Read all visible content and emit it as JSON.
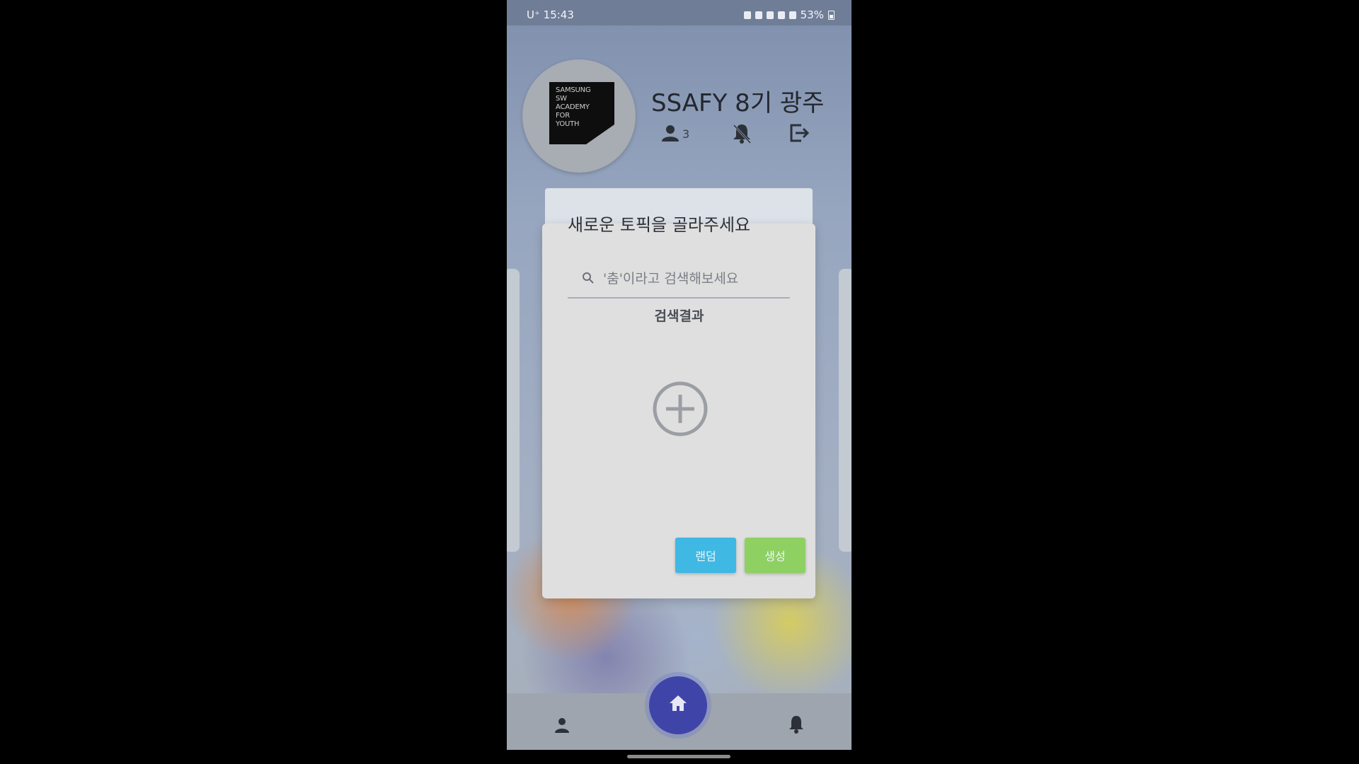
{
  "status_bar": {
    "time": "U⁺ 15:43",
    "battery": "53%"
  },
  "header": {
    "group_title": "SSAFY 8기 광주",
    "member_count": "3",
    "logo_lines": [
      "SAMSUNG",
      "SW",
      "ACADEMY",
      "FOR",
      "YOUTH"
    ]
  },
  "dialog": {
    "title": "새로운 토픽을 골라주세요",
    "search_placeholder": "'춤'이라고 검색해보세요",
    "results_label": "검색결과",
    "random_button": "랜덤",
    "create_button": "생성"
  },
  "icons": {
    "member": "person-icon",
    "notifications_off": "bell-off-icon",
    "exit": "exit-icon",
    "search": "search-icon",
    "add": "add-circle-icon",
    "nav_profile": "person-icon",
    "nav_home": "home-icon",
    "nav_notifications": "bell-icon"
  },
  "colors": {
    "random_button": "#3fb8e3",
    "create_button": "#8fd063",
    "home_fab": "#3f45a8"
  }
}
